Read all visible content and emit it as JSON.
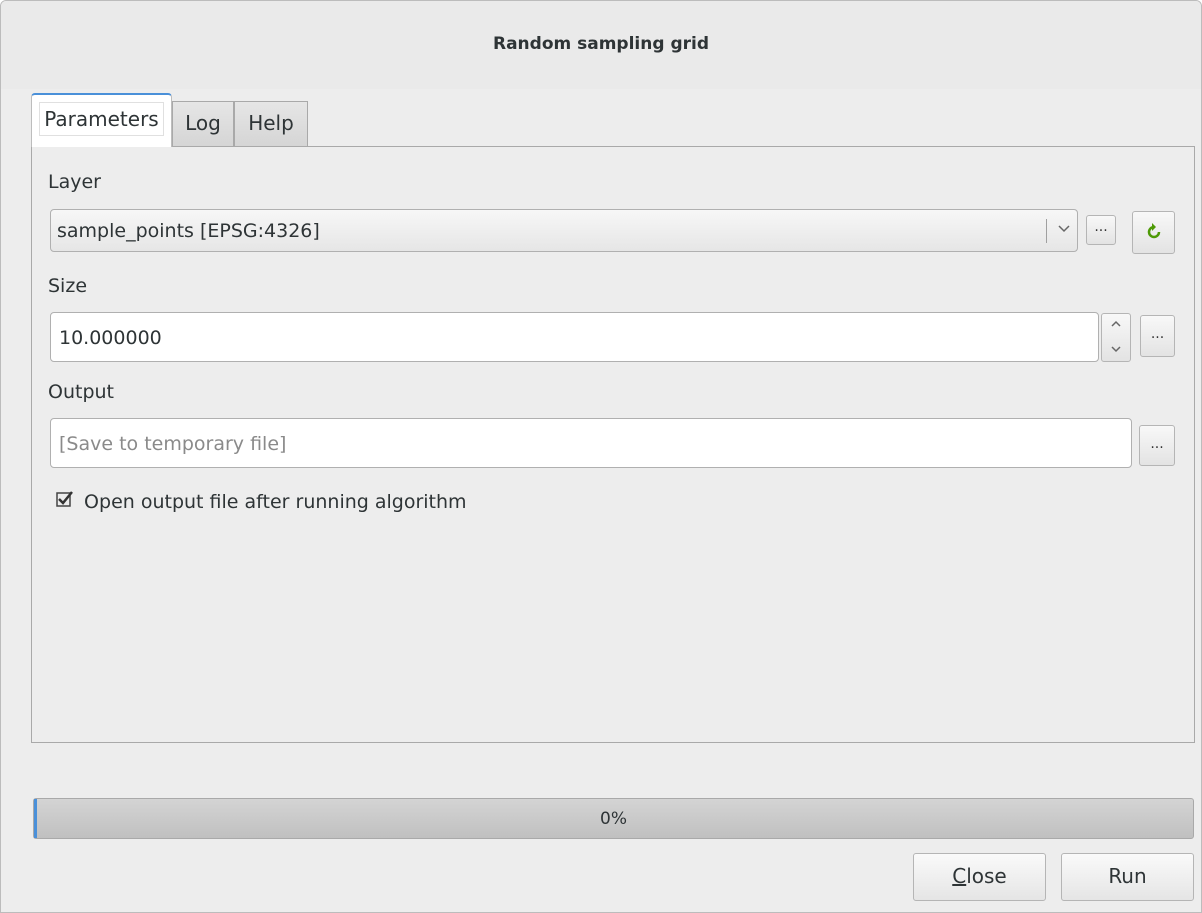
{
  "window": {
    "title": "Random sampling grid"
  },
  "tabs": [
    {
      "label": "Parameters",
      "active": true
    },
    {
      "label": "Log",
      "active": false
    },
    {
      "label": "Help",
      "active": false
    }
  ],
  "params": {
    "layer_label": "Layer",
    "layer_value": "sample_points [EPSG:4326]",
    "ellipsis": "...",
    "size_label": "Size",
    "size_value": "10.000000",
    "output_label": "Output",
    "output_placeholder": "[Save to temporary file]",
    "open_output_label": "Open output file after running algorithm",
    "open_output_checked": true
  },
  "progress": {
    "value": 0,
    "text": "0%"
  },
  "buttons": {
    "close_first": "C",
    "close_rest": "lose",
    "run": "Run"
  },
  "colors": {
    "accent": "#4a90d9",
    "refresh_icon": "#4e9a06"
  },
  "icons": [
    "chevron-down-icon",
    "refresh-icon",
    "checkmark-icon",
    "spin-up-icon",
    "spin-down-icon"
  ]
}
